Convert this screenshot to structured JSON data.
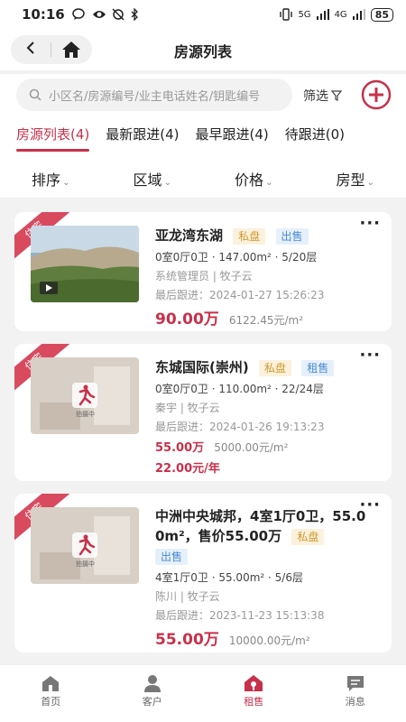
{
  "status": {
    "time": "10:16",
    "net1": "5G",
    "net2": "4G",
    "battery": "85"
  },
  "nav": {
    "title": "房源列表"
  },
  "search": {
    "placeholder": "小区名/房源编号/业主电话姓名/钥匙编号",
    "filter_label": "筛选"
  },
  "tabs": [
    {
      "label": "房源列表(4)"
    },
    {
      "label": "最新跟进(4)"
    },
    {
      "label": "最早跟进(4)"
    },
    {
      "label": "待跟进(0)"
    }
  ],
  "sorts": [
    {
      "label": "排序"
    },
    {
      "label": "区域"
    },
    {
      "label": "价格"
    },
    {
      "label": "房型"
    }
  ],
  "listings": [
    {
      "ribbon": "住宅",
      "title": "亚龙湾东湖",
      "tag_private": "私盘",
      "tag_type": "出售",
      "layout": "0室0厅0卫 · 147.00m² · 5/20层",
      "agent": "系统管理员 | 牧子云",
      "follow": "最后跟进：2024-01-27 15:26:23",
      "price": "90.00万",
      "unit_price": "6122.45元/m²"
    },
    {
      "ribbon": "住宅",
      "title": "东城国际(崇州)",
      "tag_private": "私盘",
      "tag_type": "租售",
      "layout": "0室0厅0卫 · 110.00m² · 22/24层",
      "agent": "秦宇      | 牧子云",
      "follow": "最后跟进：2024-01-26 19:13:23",
      "price": "55.00万",
      "unit_price": "5000.00元/m²",
      "rent": "22.00元/年",
      "photo_caption": "拍摄中"
    },
    {
      "ribbon": "住宅",
      "title_line1": "中洲中央城邦，4室1厅0卫，55.0",
      "title_line2": "0m²，售价55.00万",
      "tag_private": "私盘",
      "tag_type": "出售",
      "layout": "4室1厅0卫 · 55.00m² · 5/6层",
      "agent": "陈川      | 牧子云",
      "follow": "最后跟进：2023-11-23 15:13:38",
      "price": "55.00万",
      "unit_price": "10000.00元/m²",
      "photo_caption": "拍摄中"
    }
  ],
  "bottom_nav": [
    {
      "label": "首页"
    },
    {
      "label": "客户"
    },
    {
      "label": "租售"
    },
    {
      "label": "消息"
    }
  ],
  "colors": {
    "accent": "#c8304a",
    "private_tag": "#d09a2f",
    "sale_tag": "#4a8bd4"
  }
}
